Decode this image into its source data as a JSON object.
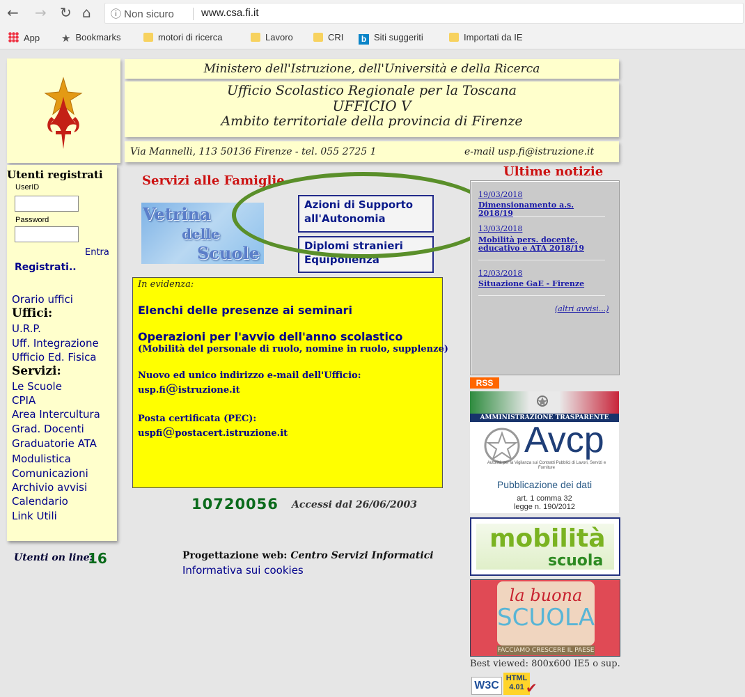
{
  "browser": {
    "security_label": "Non sicuro",
    "url": "www.csa.fi.it",
    "bookmarks": [
      "App",
      "Bookmarks",
      "motori di ricerca",
      "Lavoro",
      "CRI",
      "Siti suggeriti",
      "Importati da IE"
    ]
  },
  "header": {
    "ministero": "Ministero dell'Istruzione, dell'Università e della Ricerca",
    "ufficio_regionale": "Ufficio Scolastico Regionale per la Toscana",
    "ufficio": "UFFICIO V",
    "ambito": "Ambito territoriale della provincia di Firenze",
    "address": "Via Mannelli, 113 50136 Firenze -  tel. 055 2725 1",
    "email": "e-mail  usp.fi@istruzione.it"
  },
  "login": {
    "title": "Utenti registrati",
    "userid_label": "UserID",
    "password_label": "Password",
    "submit": "Entra",
    "register": "Registrati.."
  },
  "menu": {
    "orario": "Orario uffici",
    "uffici_heading": "Uffici:",
    "uffici": [
      "U.R.P.",
      "Uff. Integrazione",
      "Ufficio Ed. Fisica"
    ],
    "servizi_heading": "Servizi:",
    "servizi": [
      "Le Scuole",
      "CPIA",
      "Area Intercultura",
      "Grad. Docenti",
      "Graduatorie ATA",
      "Modulistica",
      "Comunicazioni",
      "Archivio avvisi",
      "Calendario",
      "Link Utili"
    ]
  },
  "online": {
    "label": "Utenti on line:",
    "count": "16"
  },
  "main": {
    "servizi_title": "Servizi alle Famiglie",
    "vetrina": [
      "Vetrina",
      "delle",
      "Scuole"
    ],
    "box1": [
      "Azioni di Supporto",
      "all'Autonomia"
    ],
    "box2": [
      "Diplomi stranieri",
      "Equipollenza"
    ],
    "evidenza": {
      "title": "In evidenza:",
      "link1": "Elenchi delle presenze ai seminari",
      "link2": "Operazioni per l'avvio dell'anno scolastico",
      "link2_sub": "(Mobilità del personale di ruolo, nomine in ruolo, supplenze)",
      "email_label": "Nuovo ed unico indirizzo e-mail dell'Ufficio:",
      "email_user": "usp.fi",
      "email_at": "@",
      "email_domain": "istruzione.it",
      "pec_label": "Posta certificata (PEC):",
      "pec_user": "uspfi",
      "pec_at": "@",
      "pec_domain": "postacert.istruzione.it"
    },
    "counter": "10720056",
    "accessi": "Accessi dal 26/06/2003",
    "proget_label": "Progettazione web:",
    "proget_name": "Centro Servizi Informatici",
    "cookies": "Informativa sui cookies"
  },
  "news": {
    "title": "Ultime notizie",
    "items": [
      {
        "date": "19/03/2018",
        "title": "Dimensionamento a.s. 2018/19"
      },
      {
        "date": "13/03/2018",
        "title": "Mobilità pers. docente, educativo e ATA 2018/19"
      },
      {
        "date": "12/03/2018",
        "title": "Situazione GaE - Firenze"
      }
    ],
    "more": "(altri avvisi...)"
  },
  "right": {
    "rss": "RSS",
    "amm": "AMMINISTRAZIONE TRASPARENTE",
    "avcp": "Avcp",
    "avcp_sub": "Autorità per la Vigilanza sui Contratti Pubblici di Lavori, Servizi e Forniture",
    "avcp_pub": "Pubblicazione dei dati",
    "avcp_art": "art. 1 comma 32",
    "avcp_legge": "legge n. 190/2012",
    "mob1": "mobilità",
    "mob2": "scuola",
    "buona1": "la buona",
    "buona2": "SCUOLA",
    "buona3": "FACCIAMO CRESCERE IL PAESE",
    "best": "Best viewed: 800x600 IE5 o sup.",
    "w3c": "W3C",
    "html": "HTML",
    "html_ver": "4.01"
  },
  "colors": {
    "link": "#00008b",
    "accent_red": "#cc1111",
    "highlight_oval": "#5a8f2a",
    "evidenza_bg": "#ffff00"
  }
}
